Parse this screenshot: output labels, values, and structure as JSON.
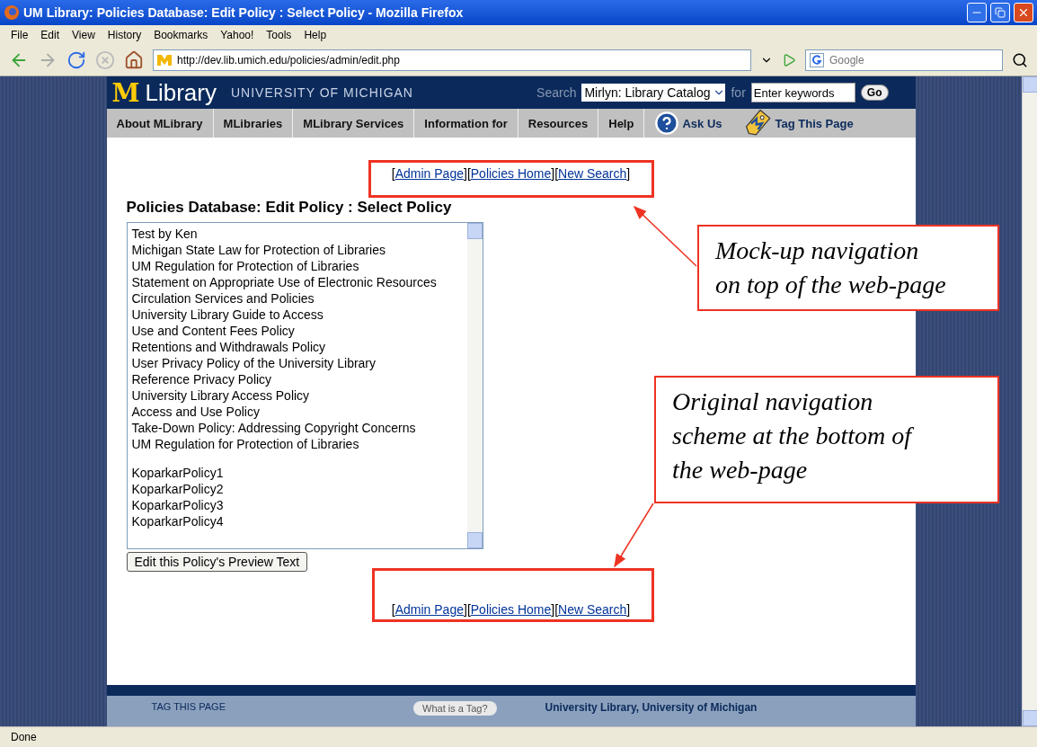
{
  "window": {
    "title": "UM Library: Policies Database: Edit Policy : Select Policy - Mozilla Firefox"
  },
  "menu": [
    "File",
    "Edit",
    "View",
    "History",
    "Bookmarks",
    "Yahoo!",
    "Tools",
    "Help"
  ],
  "toolbar": {
    "url": "http://dev.lib.umich.edu/policies/admin/edit.php",
    "search_placeholder": "Google"
  },
  "header": {
    "logo_letter": "M",
    "logo_word": "Library",
    "university": "UNIVERSITY OF MICHIGAN",
    "search_label": "Search",
    "catalog": "Mirlyn: Library Catalog",
    "for_label": "for",
    "keywords_placeholder": "Enter keywords",
    "go": "Go"
  },
  "nav": [
    {
      "label": "About MLibrary",
      "kind": "plain"
    },
    {
      "label": "MLibraries",
      "kind": "plain"
    },
    {
      "label": "MLibrary Services",
      "kind": "plain"
    },
    {
      "label": "Information for",
      "kind": "plain"
    },
    {
      "label": "Resources",
      "kind": "plain"
    },
    {
      "label": "Help",
      "kind": "plain"
    },
    {
      "label": "Ask Us",
      "kind": "help"
    },
    {
      "label": "Tag This Page",
      "kind": "tag"
    }
  ],
  "top_links": [
    {
      "open": "[",
      "label": "Admin Page",
      "close": "]"
    },
    {
      "open": "[",
      "label": "Policies Home",
      "close": "]"
    },
    {
      "open": "[",
      "label": "New Search",
      "close": "]"
    }
  ],
  "heading": "Policies Database: Edit Policy : Select Policy",
  "policy_groups": [
    [
      "Test by Ken",
      "Michigan State Law for Protection of Libraries",
      "UM Regulation for Protection of Libraries",
      "Statement on Appropriate Use of Electronic Resources",
      "Circulation Services and Policies",
      "University Library Guide to Access",
      "Use and Content Fees Policy",
      "Retentions and Withdrawals Policy",
      "User Privacy Policy of the University Library",
      "Reference Privacy Policy",
      "University Library Access Policy",
      "Access and Use Policy",
      "Take-Down Policy: Addressing Copyright Concerns",
      "UM Regulation for Protection of Libraries"
    ],
    [
      "KoparkarPolicy1",
      "KoparkarPolicy2",
      "KoparkarPolicy3",
      "KoparkarPolicy4"
    ]
  ],
  "edit_button": "Edit this Policy's Preview Text",
  "bottom_links": [
    {
      "open": "[",
      "label": "Admin Page",
      "close": "]"
    },
    {
      "open": "[",
      "label": "Policies Home",
      "close": "]"
    },
    {
      "open": "[",
      "label": "New Search",
      "close": "]"
    }
  ],
  "footer": {
    "tag_label": "TAG THIS PAGE",
    "tag_help": "What is a Tag?",
    "credit": "University Library, University of Michigan"
  },
  "annotations": [
    {
      "lines": [
        "Mock-up navigation",
        "on top of the web-page"
      ]
    },
    {
      "lines": [
        "Original navigation",
        "scheme at the bottom of",
        "the web-page"
      ]
    }
  ],
  "status_bar": "Done"
}
